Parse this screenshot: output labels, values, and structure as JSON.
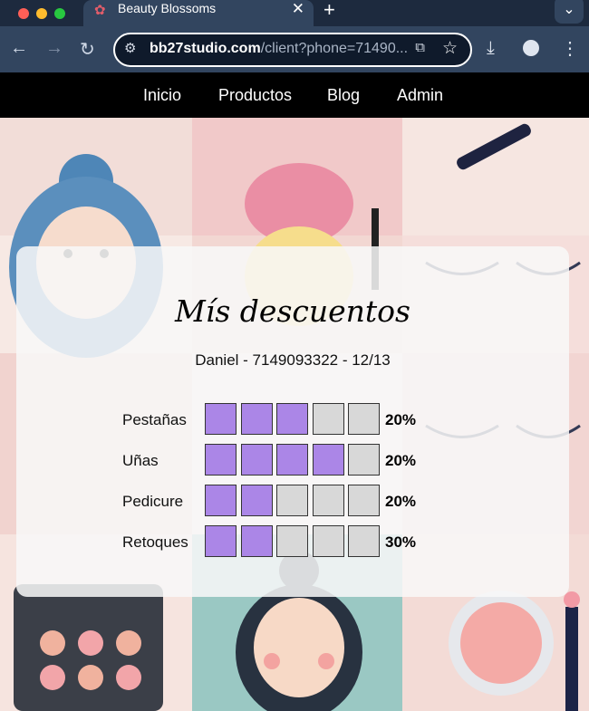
{
  "browser": {
    "tab_title": "Beauty Blossoms",
    "url_host": "bb27studio.com",
    "url_path": "/client?phone=71490..."
  },
  "nav": {
    "items": [
      "Inicio",
      "Productos",
      "Blog",
      "Admin"
    ]
  },
  "card": {
    "title": "Mís descuentos",
    "subtitle": "Daniel - 7149093322 - 12/13",
    "rows": [
      {
        "label": "Pestañas",
        "filled": 3,
        "total": 5,
        "percent": "20%"
      },
      {
        "label": "Uñas",
        "filled": 4,
        "total": 5,
        "percent": "20%"
      },
      {
        "label": "Pedicure",
        "filled": 2,
        "total": 5,
        "percent": "20%"
      },
      {
        "label": "Retoques",
        "filled": 2,
        "total": 5,
        "percent": "30%"
      }
    ]
  },
  "colors": {
    "filled_box": "#ab86e7",
    "empty_box": "#d8d8d8",
    "nav_bg": "#000000"
  }
}
